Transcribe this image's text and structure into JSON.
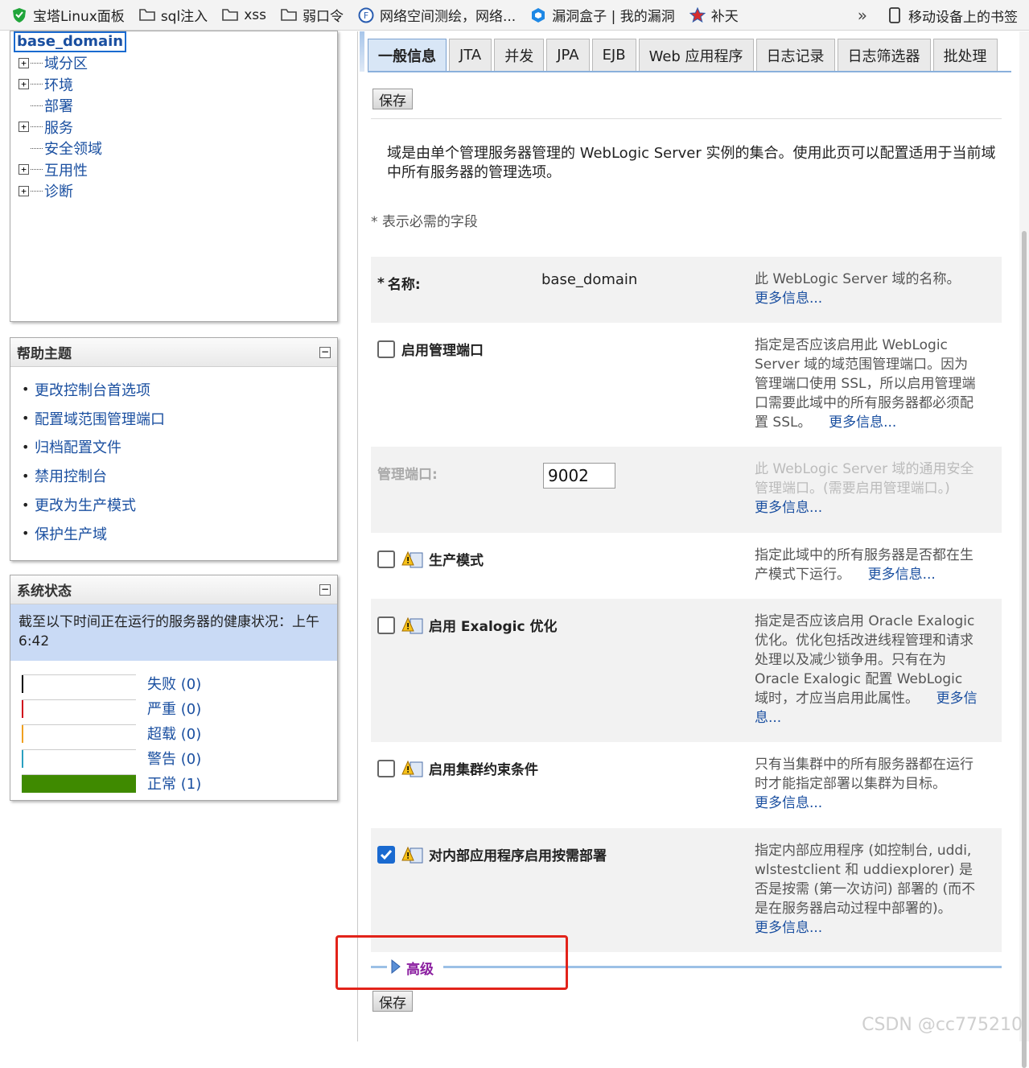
{
  "bookmarks": [
    {
      "label": "宝塔Linux面板",
      "icon": "shield-icon"
    },
    {
      "label": "sql注入",
      "icon": "folder-icon"
    },
    {
      "label": "xss",
      "icon": "folder-icon"
    },
    {
      "label": "弱口令",
      "icon": "folder-icon"
    },
    {
      "label": "网络空间测绘，网络...",
      "icon": "globe-icon"
    },
    {
      "label": "漏洞盒子 | 我的漏洞",
      "icon": "cube-icon"
    },
    {
      "label": "补天",
      "icon": "star-icon"
    }
  ],
  "bookmarks_overflow": "»",
  "mobile_bookmarks": "移动设备上的书签",
  "tree": {
    "root": "base_domain",
    "items": [
      {
        "label": "域分区",
        "expandable": true
      },
      {
        "label": "环境",
        "expandable": true
      },
      {
        "label": "部署",
        "expandable": false
      },
      {
        "label": "服务",
        "expandable": true
      },
      {
        "label": "安全领域",
        "expandable": false
      },
      {
        "label": "互用性",
        "expandable": true
      },
      {
        "label": "诊断",
        "expandable": true
      }
    ]
  },
  "help": {
    "title": "帮助主题",
    "items": [
      "更改控制台首选项",
      "配置域范围管理端口",
      "归档配置文件",
      "禁用控制台",
      "更改为生产模式",
      "保护生产域"
    ]
  },
  "status": {
    "title": "系统状态",
    "message": "截至以下时间正在运行的服务器的健康状况：上午6:42",
    "rows": [
      {
        "label": "失败 (0)",
        "color": "#000000",
        "fraction": 0
      },
      {
        "label": "严重 (0)",
        "color": "#d0021b",
        "fraction": 0
      },
      {
        "label": "超载 (0)",
        "color": "#f0a020",
        "fraction": 0
      },
      {
        "label": "警告 (0)",
        "color": "#2aa0c0",
        "fraction": 0
      },
      {
        "label": "正常 (1)",
        "color": "#3f8a00",
        "fraction": 1
      }
    ]
  },
  "tabs": [
    "一般信息",
    "JTA",
    "并发",
    "JPA",
    "EJB",
    "Web 应用程序",
    "日志记录",
    "日志筛选器",
    "批处理"
  ],
  "active_tab": "一般信息",
  "save_label": "保存",
  "intro": "域是由单个管理服务器管理的 WebLogic Server 实例的集合。使用此页可以配置适用于当前域中所有服务器的管理选项。",
  "required_note": "* 表示必需的字段",
  "fields": {
    "name": {
      "label": "名称:",
      "required_mark": "*",
      "value": "base_domain",
      "help": "此 WebLogic Server 域的名称。",
      "more": "更多信息..."
    },
    "admin_port_enabled": {
      "label": "启用管理端口",
      "checked": false,
      "help": "指定是否应该启用此 WebLogic Server 域的域范围管理端口。因为管理端口使用 SSL，所以启用管理端口需要此域中的所有服务器都必须配置 SSL。",
      "more": "更多信息..."
    },
    "admin_port": {
      "label": "管理端口:",
      "value": "9002",
      "help": "此 WebLogic Server 域的通用安全管理端口。(需要启用管理端口。)",
      "more": "更多信息..."
    },
    "production_mode": {
      "label": "生产模式",
      "checked": false,
      "help": "指定此域中的所有服务器是否都在生产模式下运行。",
      "more": "更多信息..."
    },
    "exalogic": {
      "label": "启用 Exalogic 优化",
      "checked": false,
      "help": "指定是否应该启用 Oracle Exalogic 优化。优化包括改进线程管理和请求处理以及减少锁争用。只有在为 Oracle Exalogic 配置 WebLogic 域时，才应当启用此属性。",
      "more": "更多信息..."
    },
    "cluster_constraints": {
      "label": "启用集群约束条件",
      "checked": false,
      "help": "只有当集群中的所有服务器都在运行时才能指定部署以集群为目标。",
      "more": "更多信息..."
    },
    "on_demand_deploy": {
      "label": "对内部应用程序启用按需部署",
      "checked": true,
      "help": "指定内部应用程序 (如控制台, uddi, wlstestclient 和 uddiexplorer) 是否是按需 (第一次访问) 部署的 (而不是在服务器启动过程中部署的)。",
      "more": "更多信息..."
    }
  },
  "advanced_label": "高级",
  "watermark": "CSDN @cc775210"
}
